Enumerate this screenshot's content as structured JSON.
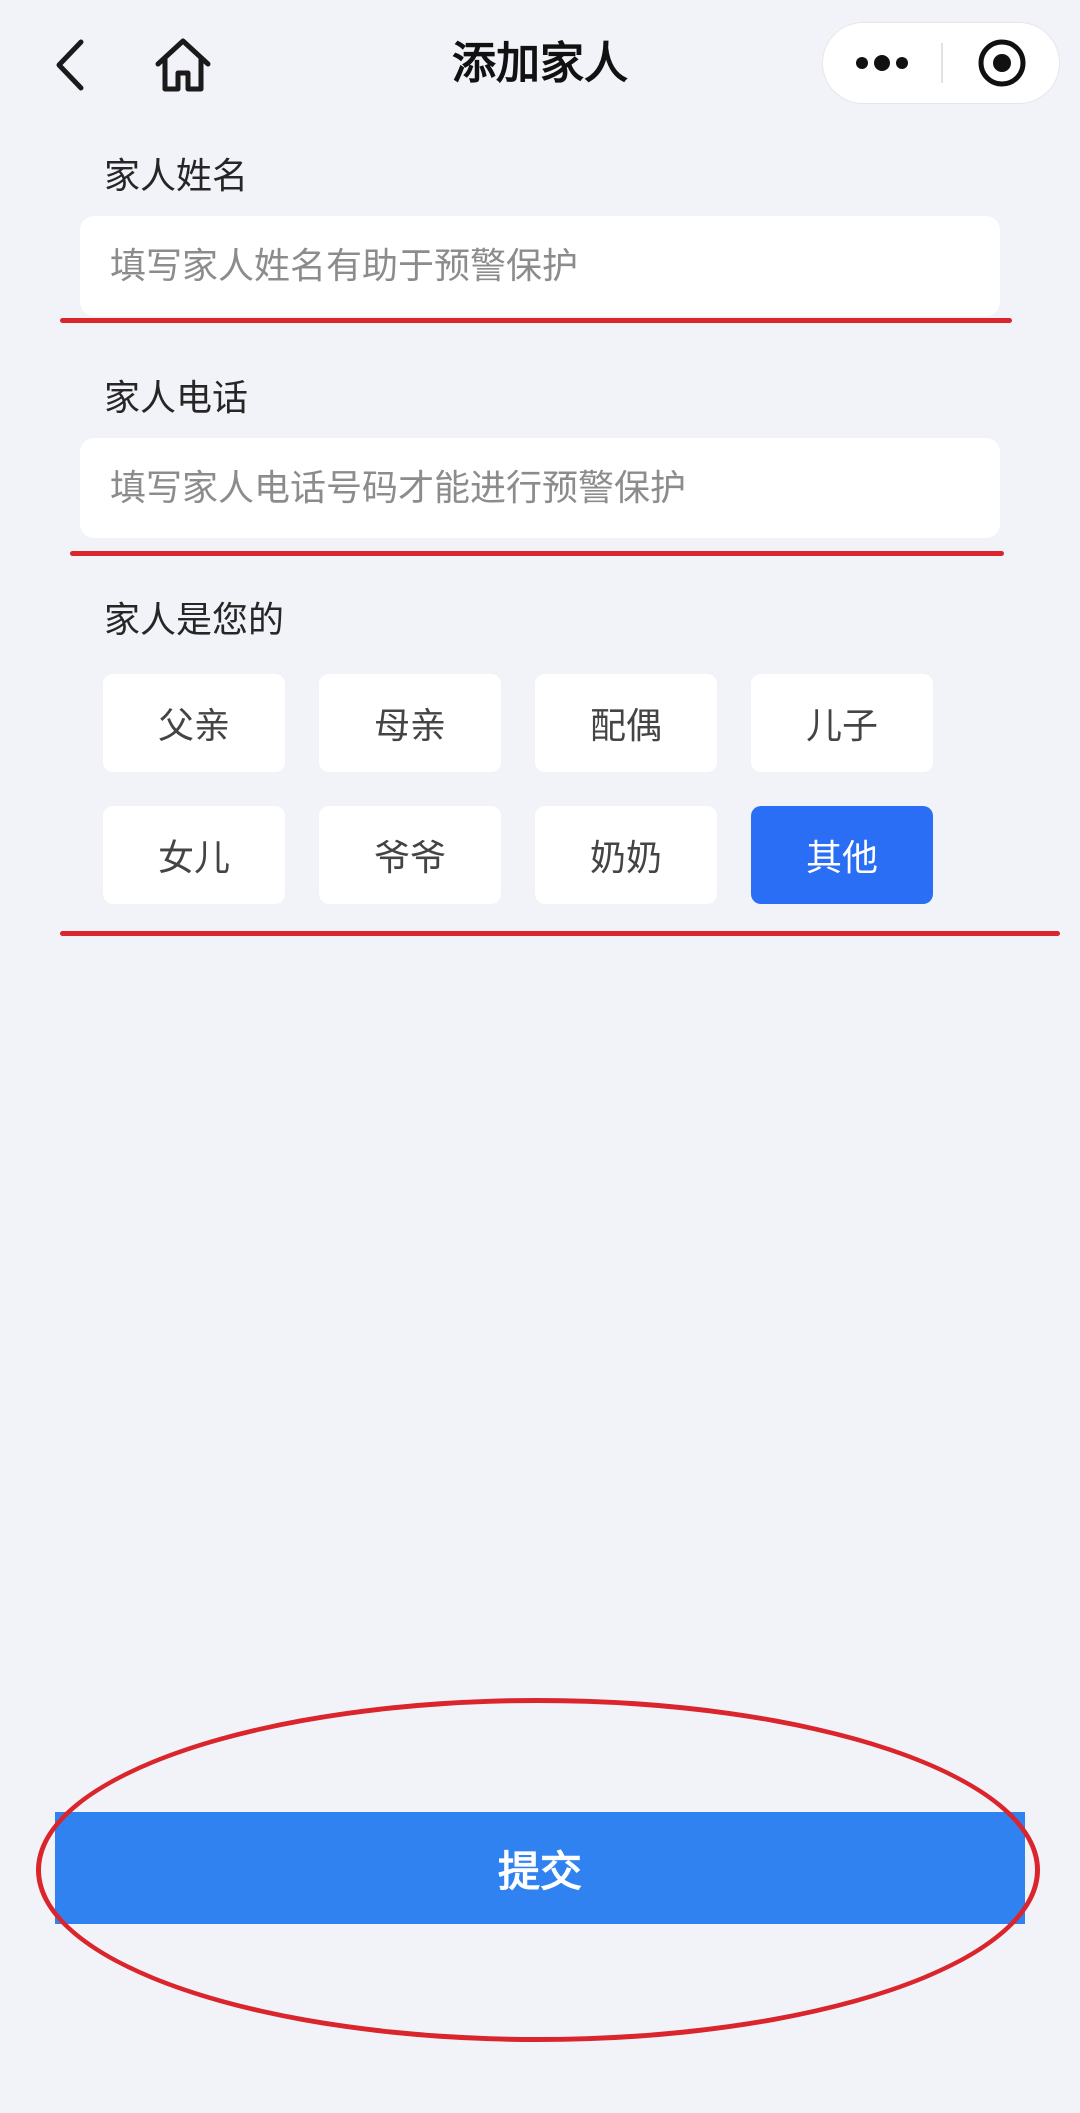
{
  "header": {
    "title": "添加家人"
  },
  "form": {
    "name": {
      "label": "家人姓名",
      "placeholder": "填写家人姓名有助于预警保护"
    },
    "phone": {
      "label": "家人电话",
      "placeholder": "填写家人电话号码才能进行预警保护"
    },
    "relation": {
      "label": "家人是您的",
      "options": [
        "父亲",
        "母亲",
        "配偶",
        "儿子",
        "女儿",
        "爷爷",
        "奶奶",
        "其他"
      ],
      "selected": "其他"
    }
  },
  "submit": {
    "label": "提交"
  },
  "colors": {
    "background": "#f2f3f8",
    "accent": "#2f82f0",
    "selected_option": "#2a6ef5",
    "annotation_red": "#d9252b"
  },
  "icons": {
    "back": "chevron-left-icon",
    "home": "home-icon",
    "more": "more-dots-icon",
    "close": "target-circle-icon"
  }
}
